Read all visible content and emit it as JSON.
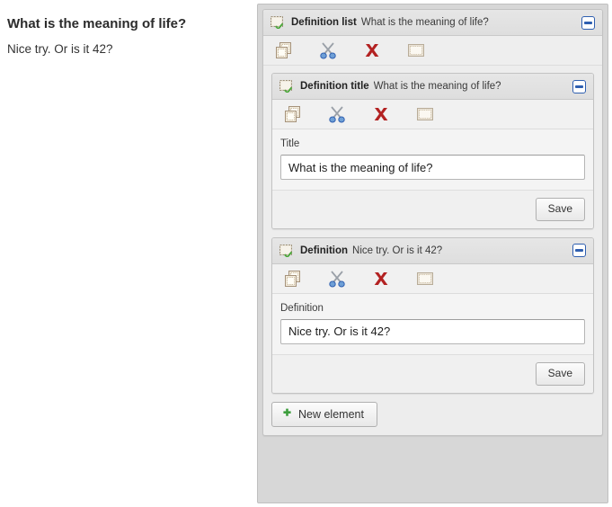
{
  "content": {
    "title": "What is the meaning of life?",
    "definition": "Nice try. Or is it 42?"
  },
  "editor": {
    "toolbar_icons": [
      {
        "name": "copy-icon",
        "label": "Copy"
      },
      {
        "name": "cut-scissors-icon",
        "label": "Cut"
      },
      {
        "name": "delete-x-icon",
        "label": "Delete"
      },
      {
        "name": "paste-icon",
        "label": "Paste"
      }
    ],
    "collapse_label": "−",
    "new_element_label": "New element",
    "new_element_plus": "✚",
    "panels": {
      "root": {
        "type": "Definition list",
        "subtitle": "What is the meaning of life?"
      },
      "title": {
        "type": "Definition title",
        "subtitle": "What is the meaning of life?",
        "field_label": "Title",
        "field_value": "What is the meaning of life?",
        "field_placeholder": "Title",
        "save_label": "Save"
      },
      "definition": {
        "type": "Definition",
        "subtitle": "Nice try. Or is it 42?",
        "field_label": "Definition",
        "field_value": "Nice try. Or is it 42?",
        "field_placeholder": "Definition",
        "save_label": "Save"
      }
    }
  },
  "colors": {
    "accent_blue": "#2f5fb0",
    "plus_green": "#3d9e3d",
    "delete_red": "#b32222",
    "frame_gray": "#d7d7d7"
  }
}
